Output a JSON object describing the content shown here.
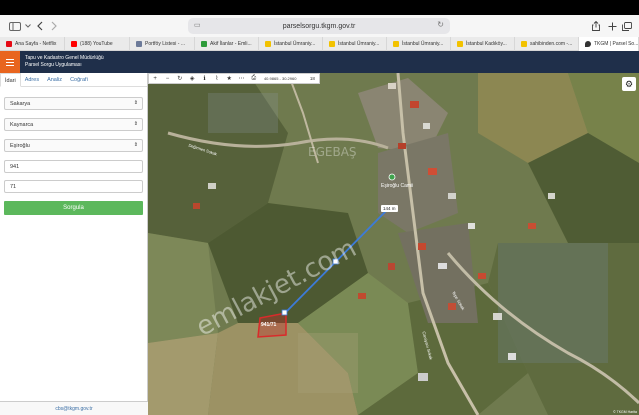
{
  "browser": {
    "url": "parselsorgu.tkgm.gov.tr",
    "icons": [
      "sidebar-icon",
      "back-icon",
      "forward-icon",
      "share-icon",
      "new-tab-icon",
      "tabs-icon"
    ]
  },
  "tabs": [
    {
      "label": "Ana Sayfa - Netflix",
      "color": "#e50914"
    },
    {
      "label": "(188) YouTube",
      "color": "#ff0000"
    },
    {
      "label": "Portföy Listesi - ...",
      "color": "#6c7a99"
    },
    {
      "label": "Akif İlanlar - Emli...",
      "color": "#2e9b3a"
    },
    {
      "label": "İstanbul Ümraniy...",
      "color": "#f2c200"
    },
    {
      "label": "İstanbul Ümraniy...",
      "color": "#f2c200"
    },
    {
      "label": "İstanbul Ümraniy...",
      "color": "#f2c200"
    },
    {
      "label": "İstanbul Kadıköy...",
      "color": "#f2c200"
    },
    {
      "label": "sahibinden.com -...",
      "color": "#f2c200"
    },
    {
      "label": "TKGM | Parsel So...",
      "color": "#333333"
    }
  ],
  "app": {
    "title_line1": "Tapu ve Kadastro Genel Müdürlüğü",
    "title_line2": "Parsel Sorgu Uygulaması"
  },
  "panel": {
    "tabs": [
      "İdari",
      "Adres",
      "Analiz",
      "Coğrafi"
    ],
    "province": "Sakarya",
    "district": "Kaynarca",
    "neighborhood": "Eşiroğlu",
    "block": "941",
    "parcel": "71",
    "submit_label": "Sorgula",
    "footer_email": "cbs@tkgm.gov.tr"
  },
  "map": {
    "coordinates": "40.9865 - 30.2960",
    "zoom": "18",
    "parcel_label": "941/71",
    "place_label": "Eşiroğlu Camii",
    "measure_label": "144 m",
    "watermark": "emlakjet.com",
    "watermark_small": "EGEBAŞ",
    "road_label_1": "Değirmen Sokak",
    "road_label_2": "Tepe Sokak",
    "road_label_3": "Camiyanı Sokak",
    "attribution": "© TKGM Harita"
  }
}
